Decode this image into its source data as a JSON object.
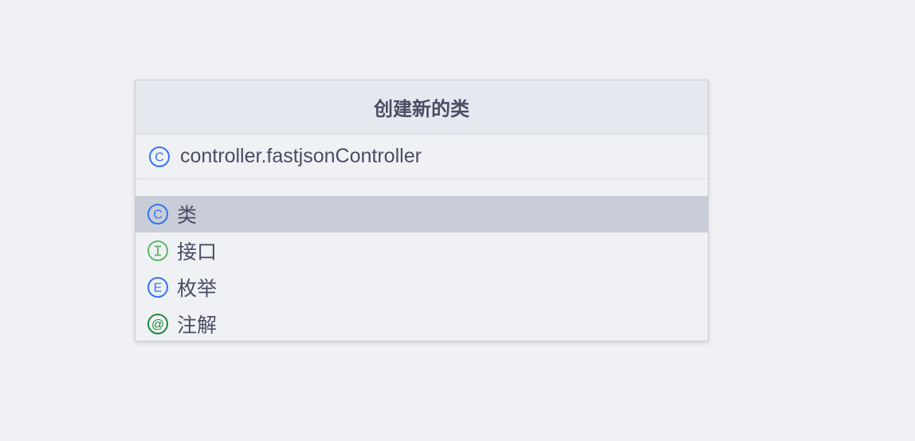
{
  "dialog": {
    "title": "创建新的类",
    "name_field": {
      "value": "controller.fastjsonController",
      "icon": "class-icon"
    },
    "kinds": [
      {
        "label": "类",
        "icon": "class-icon",
        "icon_letter": "C",
        "color": "#3574f0",
        "selected": true
      },
      {
        "label": "接口",
        "icon": "interface-icon",
        "icon_letter": "I",
        "color": "#5fb865",
        "selected": false
      },
      {
        "label": "枚举",
        "icon": "enum-icon",
        "icon_letter": "E",
        "color": "#3574f0",
        "selected": false
      },
      {
        "label": "注解",
        "icon": "annotation-icon",
        "icon_letter": "@",
        "color": "#208a3c",
        "selected": false
      }
    ]
  }
}
